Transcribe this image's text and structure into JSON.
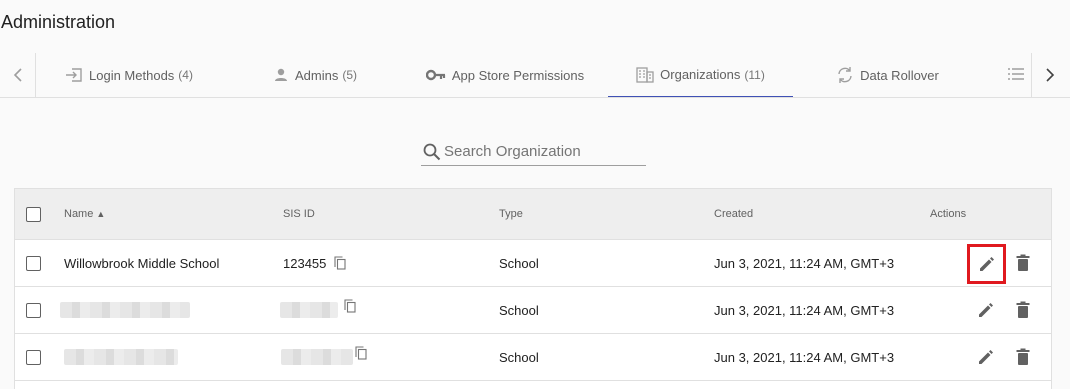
{
  "page": {
    "title": "Administration"
  },
  "tabs": [
    {
      "label": "Login Methods",
      "count": "(4)",
      "icon": "login-icon"
    },
    {
      "label": "Admins",
      "count": "(5)",
      "icon": "person-icon"
    },
    {
      "label": "App Store Permissions",
      "count": "",
      "icon": "key-icon"
    },
    {
      "label": "Organizations",
      "count": "(11)",
      "icon": "building-icon",
      "active": true
    },
    {
      "label": "Data Rollover",
      "count": "",
      "icon": "sync-icon"
    }
  ],
  "search": {
    "placeholder": "Search Organization",
    "value": ""
  },
  "table": {
    "headers": {
      "name": "Name",
      "sis_id": "SIS ID",
      "type": "Type",
      "created": "Created",
      "actions": "Actions"
    },
    "sort": {
      "column": "name",
      "direction": "asc"
    },
    "rows": [
      {
        "name": "Willowbrook Middle School",
        "sis_id": "123455",
        "type": "School",
        "created": "Jun 3, 2021, 11:24 AM, GMT+3",
        "redacted": false
      },
      {
        "name": "",
        "sis_id": "",
        "type": "School",
        "created": "Jun 3, 2021, 11:24 AM, GMT+3",
        "redacted": true
      },
      {
        "name": "",
        "sis_id": "",
        "type": "School",
        "created": "Jun 3, 2021, 11:24 AM, GMT+3",
        "redacted": true
      }
    ]
  },
  "colors": {
    "accent": "#3f51b5",
    "highlight": "#e0191f",
    "header_bg": "#eeeeee"
  }
}
